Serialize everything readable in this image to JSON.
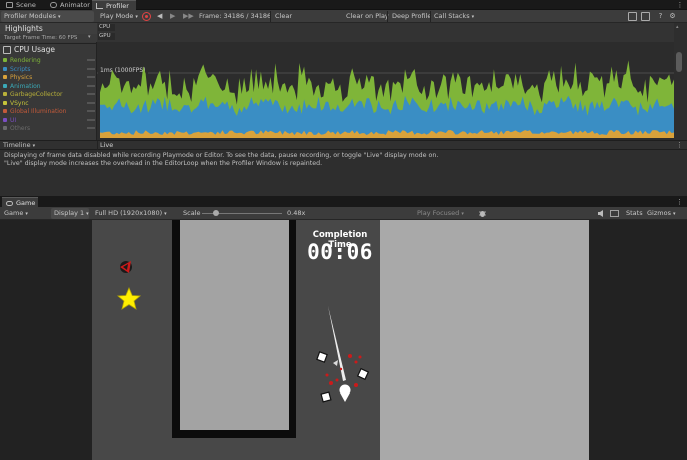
{
  "tabs": {
    "scene": "Scene",
    "animator": "Animator",
    "profiler": "Profiler"
  },
  "profiler_toolbar": {
    "modules_label": "Profiler Modules",
    "mode_label": "Play Mode",
    "frame_label": "Frame: 34186 / 34186",
    "clear_label": "Clear",
    "clear_on_play_label": "Clear on Play",
    "deep_profile_label": "Deep Profile",
    "call_stacks_label": "Call Stacks"
  },
  "highlights": {
    "title": "Highlights",
    "target_label": "Target Frame Time: 60 FPS",
    "cpu_label": "CPU",
    "gpu_label": "GPU"
  },
  "cpu_usage": {
    "title": "CPU Usage",
    "threshold_label": "1ms (1000FPS)",
    "categories": [
      {
        "label": "Rendering",
        "color": "#7fb539"
      },
      {
        "label": "Scripts",
        "color": "#3a8ec4"
      },
      {
        "label": "Physics",
        "color": "#d9a23b"
      },
      {
        "label": "Animation",
        "color": "#3ba9b7"
      },
      {
        "label": "GarbageCollector",
        "color": "#b8b03a"
      },
      {
        "label": "VSync",
        "color": "#c4c43a"
      },
      {
        "label": "Global Illumination",
        "color": "#c35a3a"
      },
      {
        "label": "UI",
        "color": "#7a4ec4"
      },
      {
        "label": "Others",
        "color": "#6b6b6b"
      }
    ]
  },
  "timeline": {
    "view_label": "Timeline",
    "live_label": "Live"
  },
  "message": {
    "line1": "Displaying of frame data disabled while recording Playmode or Editor. To see the data, pause recording, or toggle \"Live\" display mode on.",
    "line2": "\"Live\" display mode increases the overhead in the EditorLoop when the Profiler Window is repainted."
  },
  "game_tab": {
    "title": "Game"
  },
  "game_toolbar": {
    "view_label": "Game",
    "display_label": "Display 1",
    "resolution_label": "Full HD (1920x1080)",
    "scale_label": "Scale",
    "scale_value": "0.48x",
    "scale_fraction": 0.18,
    "play_mode_label": "Play Focused",
    "stats_label": "Stats",
    "gizmos_label": "Gizmos"
  },
  "game_view": {
    "completion_title": "Completion Time",
    "completion_time": "00:06"
  },
  "colors": {
    "rendering": "#7fb539",
    "scripts": "#3a8ec4",
    "physics": "#d9a23b",
    "star": "#ffee00",
    "enemy": "#cc1a1a"
  }
}
